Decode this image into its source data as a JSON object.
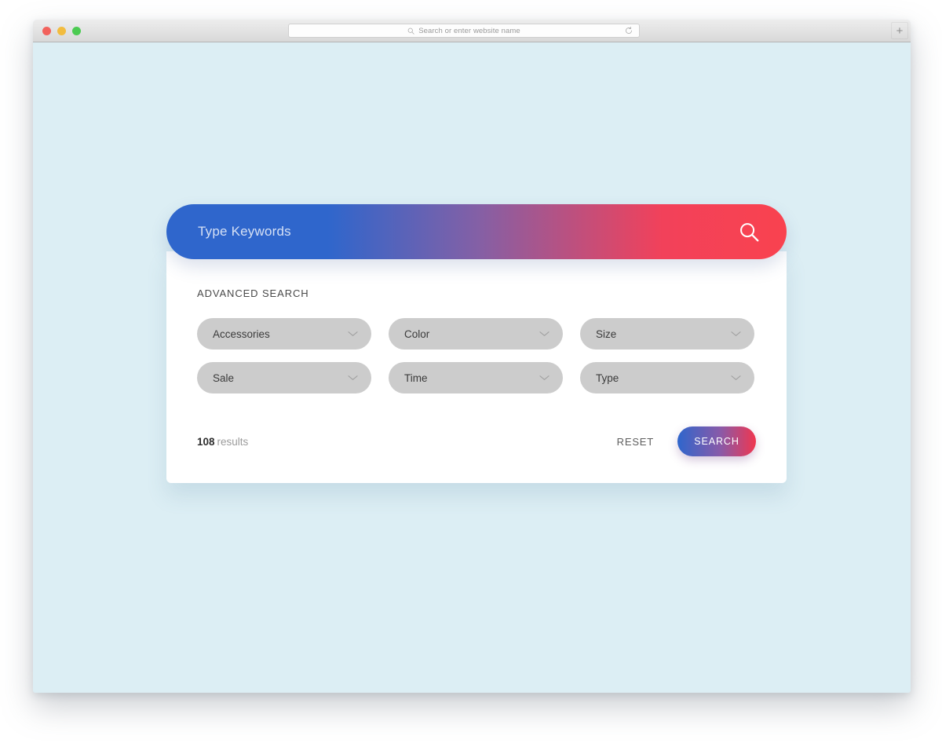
{
  "browser": {
    "traffic_lights": [
      "close",
      "minimize",
      "zoom"
    ],
    "address_placeholder": "Search or enter website name",
    "address_value": "",
    "new_tab_label": "+",
    "icons": {
      "address_search": "search-icon",
      "reload": "reload-icon"
    }
  },
  "page": {
    "background_color": "#dceef4"
  },
  "search_bar": {
    "placeholder": "Type Keywords",
    "value": "",
    "submit_icon": "search-icon",
    "gradient_from": "#2f66cc",
    "gradient_to": "#f9424f"
  },
  "advanced_panel": {
    "title": "ADVANCED SEARCH",
    "filters": [
      {
        "name": "accessories",
        "label": "Accessories"
      },
      {
        "name": "color",
        "label": "Color"
      },
      {
        "name": "size",
        "label": "Size"
      },
      {
        "name": "sale",
        "label": "Sale"
      },
      {
        "name": "time",
        "label": "Time"
      },
      {
        "name": "type",
        "label": "Type"
      }
    ],
    "results": {
      "count": "108",
      "word": "results"
    },
    "reset_label": "RESET",
    "search_label": "SEARCH"
  }
}
